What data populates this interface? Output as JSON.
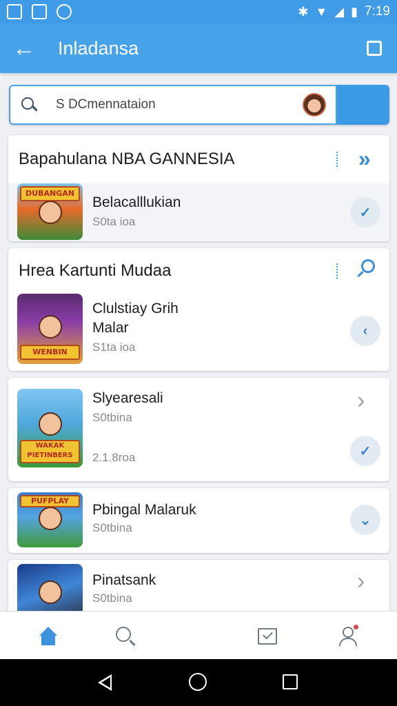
{
  "status_bar": {
    "time": "7:19"
  },
  "app_bar": {
    "title": "Inladansa"
  },
  "search": {
    "value": "S DCmennataion",
    "placeholder": "S DCmennataion"
  },
  "sections": [
    {
      "header": "Bapahulana NBA GANNESIA",
      "items": [
        {
          "title": "Belacalllukian",
          "subtitle": "S0ta ioa",
          "thumb_label": "DUBANGAN"
        }
      ]
    },
    {
      "header": "Hrea Kartunti Mudaa",
      "items": [
        {
          "title": "Clulstiay Grih\nMalar",
          "subtitle": "S1ta ioa",
          "thumb_label": "WENBIN"
        }
      ]
    }
  ],
  "cards": [
    {
      "title": "Slyearesali",
      "subtitle": "S0tbina",
      "extra": "2.1.8roa",
      "thumb_label": "WAKAK PIETINBERS"
    },
    {
      "title": "Pbingal Malaruk",
      "subtitle": "S0tbina",
      "thumb_label": "PUFPLAY"
    },
    {
      "title": "Pinatsank",
      "subtitle": "S0tbina"
    }
  ],
  "bottom_nav": {
    "items": [
      {
        "name": "home",
        "icon": "home-icon"
      },
      {
        "name": "search",
        "icon": "search-icon"
      },
      {
        "name": "inbox",
        "icon": "inbox-icon"
      },
      {
        "name": "profile",
        "icon": "profile-icon"
      }
    ]
  },
  "colors": {
    "primary": "#46a3ea",
    "accent": "#3a86c8",
    "badge": "#e04848"
  }
}
